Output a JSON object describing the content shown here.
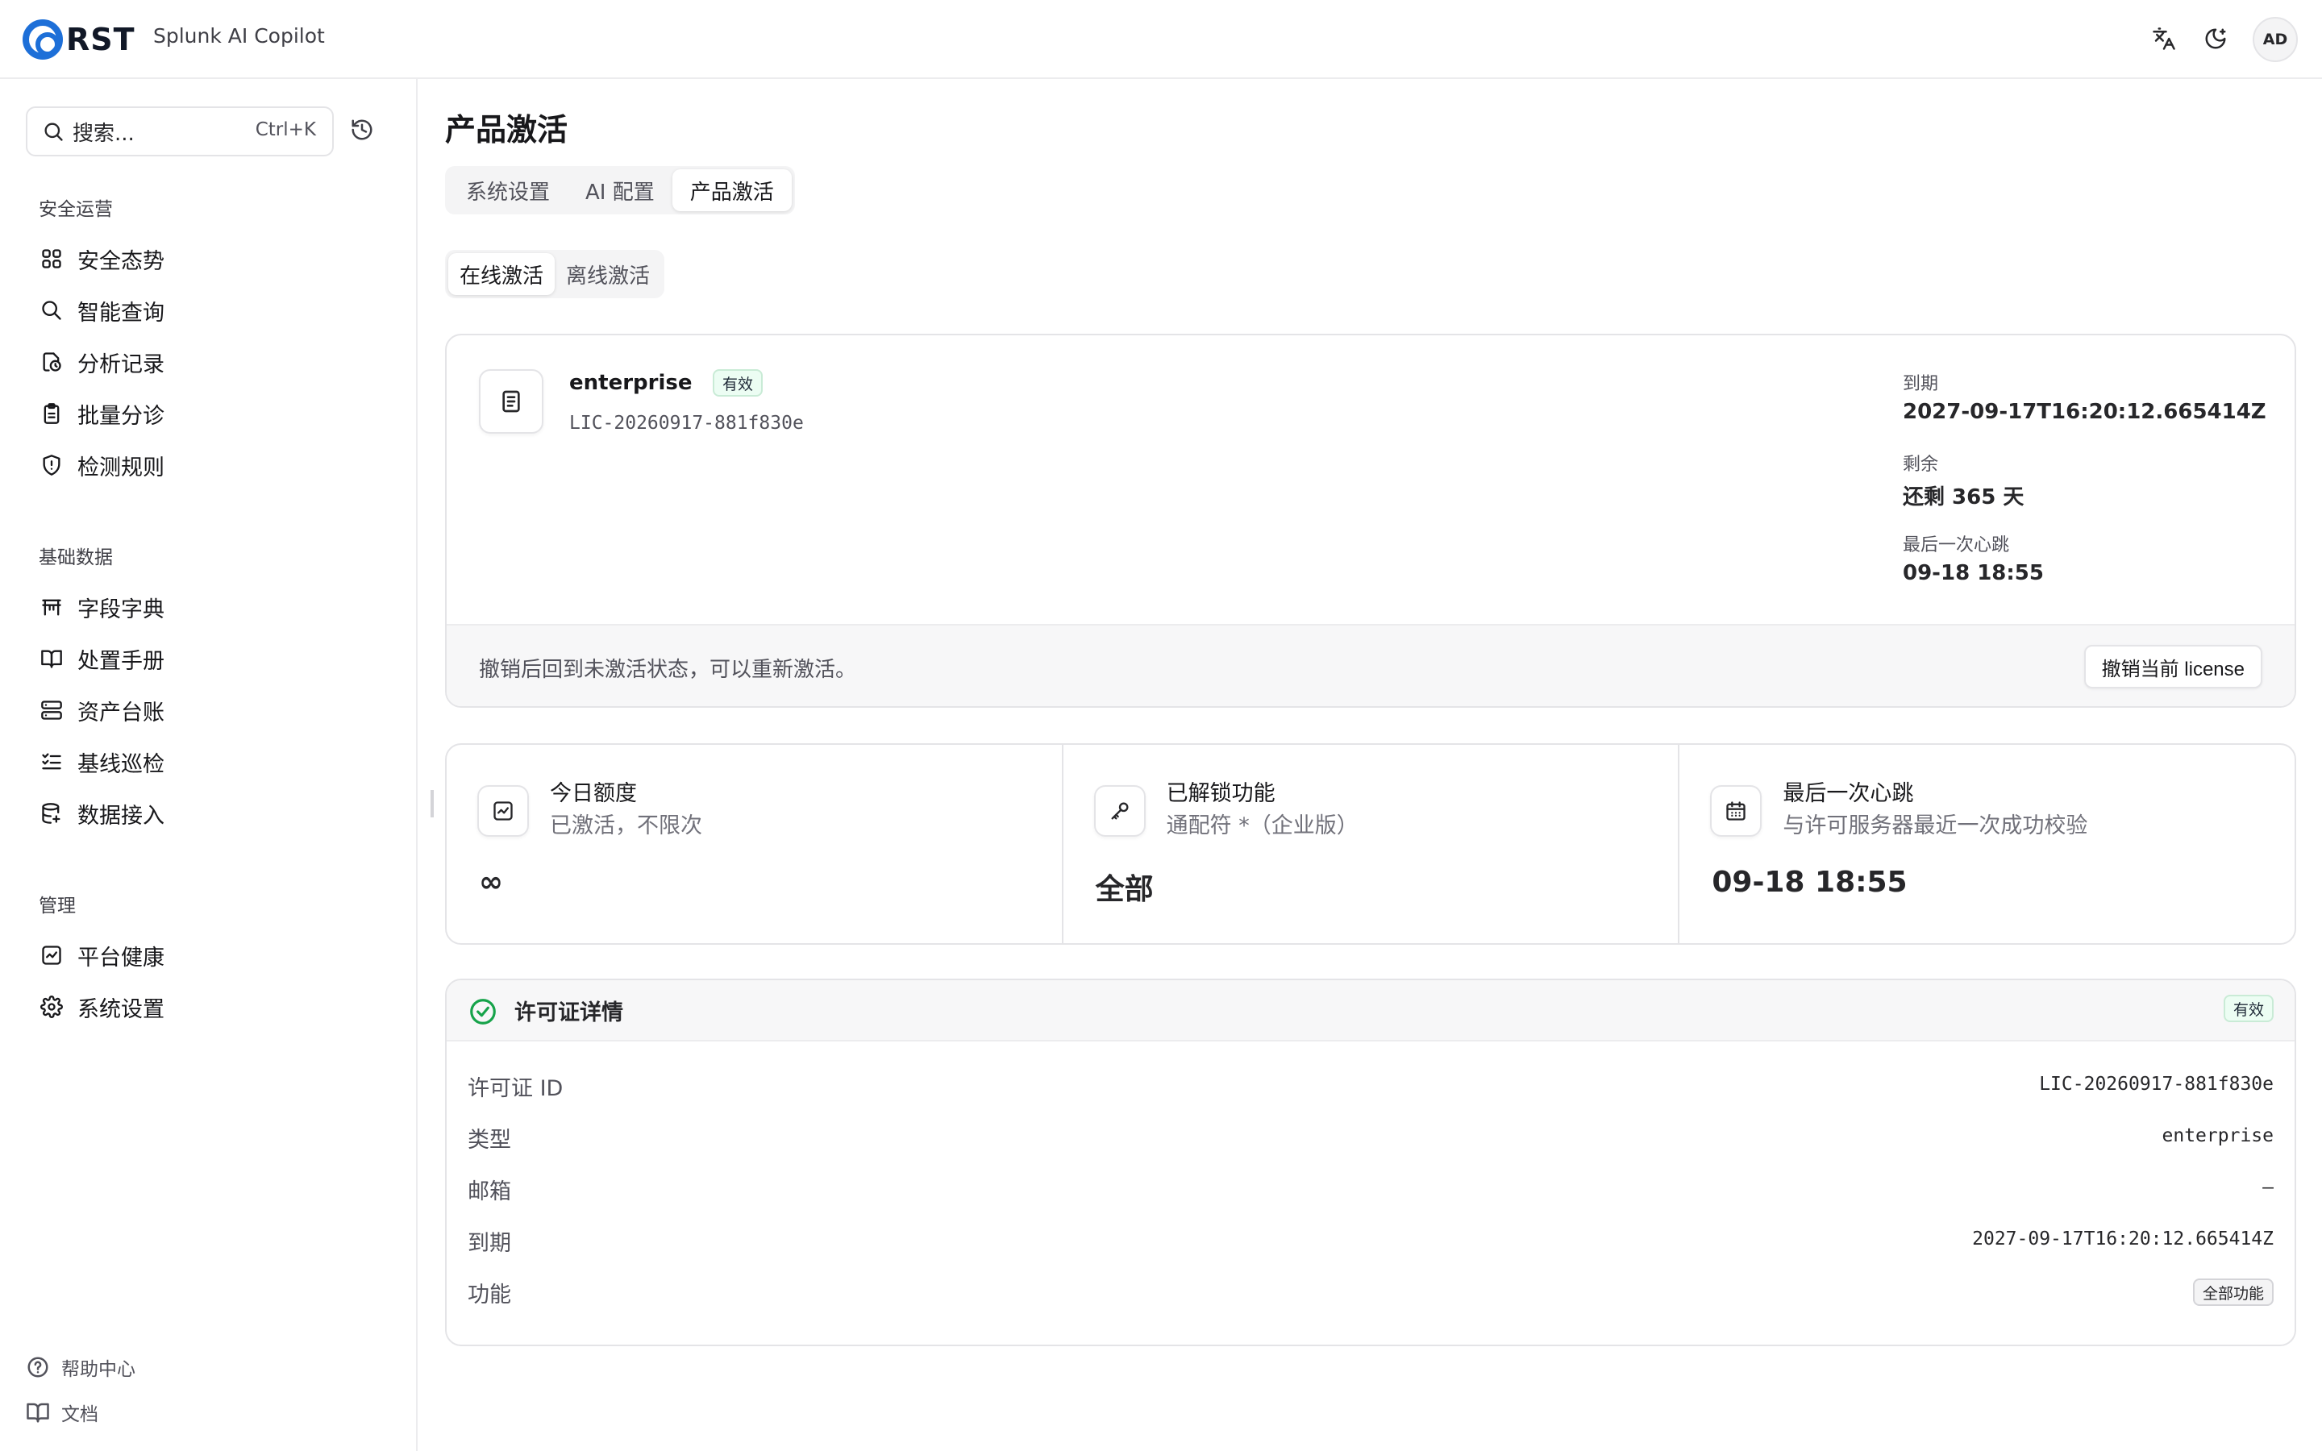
{
  "header": {
    "logo_text": "RST",
    "app_name": "Splunk AI Copilot",
    "avatar_initials": "AD",
    "icons": [
      "translate-icon",
      "theme-toggle-icon"
    ]
  },
  "sidebar": {
    "search_placeholder": "搜索...",
    "search_shortcut": "Ctrl+K",
    "sections": [
      {
        "label": "安全运营",
        "items": [
          {
            "label": "安全态势",
            "icon": "dashboard-grid-icon"
          },
          {
            "label": "智能查询",
            "icon": "search-icon"
          },
          {
            "label": "分析记录",
            "icon": "history-record-icon"
          },
          {
            "label": "批量分诊",
            "icon": "clipboard-icon"
          },
          {
            "label": "检测规则",
            "icon": "shield-alert-icon"
          }
        ]
      },
      {
        "label": "基础数据",
        "items": [
          {
            "label": "字段字典",
            "icon": "table-icon"
          },
          {
            "label": "处置手册",
            "icon": "book-icon"
          },
          {
            "label": "资产台账",
            "icon": "server-icon"
          },
          {
            "label": "基线巡检",
            "icon": "list-check-icon"
          },
          {
            "label": "数据接入",
            "icon": "database-icon"
          }
        ]
      },
      {
        "label": "管理",
        "items": [
          {
            "label": "平台健康",
            "icon": "activity-icon"
          },
          {
            "label": "系统设置",
            "icon": "gear-icon"
          }
        ]
      }
    ],
    "footer": [
      {
        "label": "帮助中心",
        "icon": "help-icon"
      },
      {
        "label": "文档",
        "icon": "book-open-icon"
      }
    ]
  },
  "main": {
    "title": "产品激活",
    "tabs": [
      {
        "label": "系统设置",
        "active": false
      },
      {
        "label": "AI 配置",
        "active": false
      },
      {
        "label": "产品激活",
        "active": true
      }
    ],
    "subtabs": [
      {
        "label": "在线激活",
        "active": true
      },
      {
        "label": "离线激活",
        "active": false
      }
    ],
    "license": {
      "type": "enterprise",
      "status": "有效",
      "id": "LIC-20260917-881f830e",
      "expiry_label": "到期",
      "expiry_value": "2027-09-17T16:20:12.665414Z",
      "remaining_label": "剩余",
      "remaining_value": "还剩 365 天",
      "heartbeat_label": "最后一次心跳",
      "heartbeat_value": "09-18 18:55",
      "revoke_hint": "撤销后回到未激活状态，可以重新激活。",
      "revoke_button": "撤销当前 license"
    },
    "stats": [
      {
        "title": "今日额度",
        "subtitle": "已激活，不限次",
        "value": "∞",
        "icon": "chart-icon"
      },
      {
        "title": "已解锁功能",
        "subtitle": "通配符 *（企业版）",
        "value": "全部",
        "icon": "key-icon"
      },
      {
        "title": "最后一次心跳",
        "subtitle": "与许可服务器最近一次成功校验",
        "value": "09-18 18:55",
        "icon": "calendar-icon"
      }
    ],
    "details": {
      "title": "许可证详情",
      "status": "有效",
      "rows": [
        {
          "label": "许可证 ID",
          "value": "LIC-20260917-881f830e"
        },
        {
          "label": "类型",
          "value": "enterprise"
        },
        {
          "label": "邮箱",
          "value": "—"
        },
        {
          "label": "到期",
          "value": "2027-09-17T16:20:12.665414Z"
        },
        {
          "label": "功能",
          "value": "全部功能"
        }
      ]
    }
  },
  "colors": {
    "brand": "#1d6fd8",
    "success": "#16a34a",
    "badge_green_bg": "#ecfdf3"
  }
}
